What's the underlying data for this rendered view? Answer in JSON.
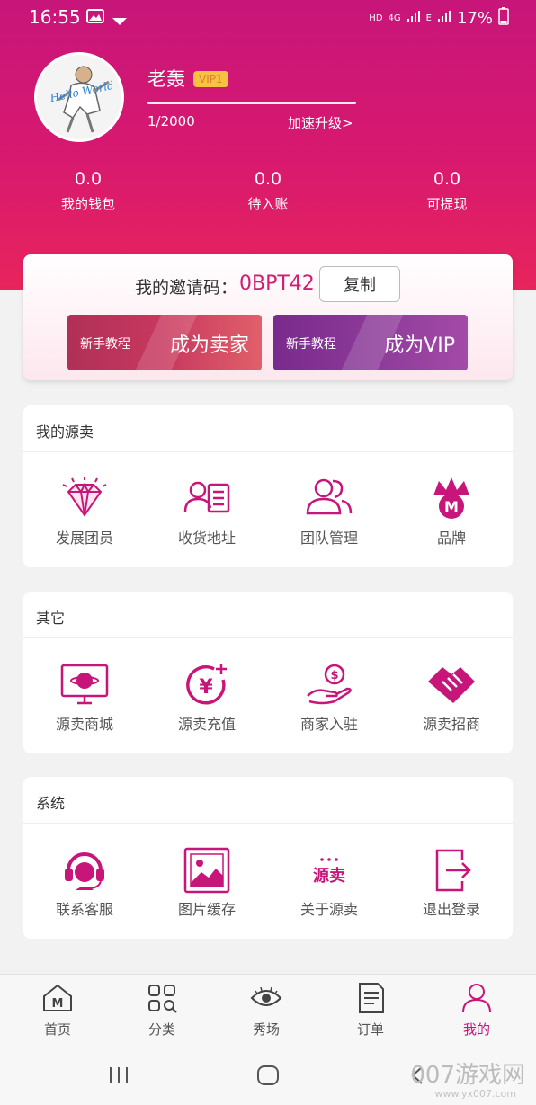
{
  "status_bar": {
    "time": "16:55",
    "hd": "HD",
    "net1": "4G",
    "net2": "E",
    "battery": "17%"
  },
  "profile": {
    "name": "老轰",
    "vip": "VIP1",
    "avatar_text": "Hello World",
    "level_progress": "1/2000",
    "upgrade_label": "加速升级>"
  },
  "stats": [
    {
      "value": "0.0",
      "label": "我的钱包"
    },
    {
      "value": "0.0",
      "label": "待入账"
    },
    {
      "value": "0.0",
      "label": "可提现"
    }
  ],
  "invite": {
    "label": "我的邀请码：",
    "code": "0BPT42",
    "copy_label": "复制",
    "seller_tag": "新手教程",
    "seller_label": "成为卖家",
    "vip_tag": "新手教程",
    "vip_label": "成为VIP"
  },
  "sections": [
    {
      "title": "我的源卖",
      "items": [
        {
          "label": "发展团员",
          "icon": "diamond-icon"
        },
        {
          "label": "收货地址",
          "icon": "address-card-icon"
        },
        {
          "label": "团队管理",
          "icon": "team-icon"
        },
        {
          "label": "品牌",
          "icon": "crown-brand-icon",
          "badge": "M"
        }
      ]
    },
    {
      "title": "其它",
      "items": [
        {
          "label": "源卖商城",
          "icon": "monitor-mall-icon"
        },
        {
          "label": "源卖充值",
          "icon": "yen-recharge-icon",
          "symbol": "¥"
        },
        {
          "label": "商家入驻",
          "icon": "hand-coin-icon",
          "symbol": "$"
        },
        {
          "label": "源卖招商",
          "icon": "handshake-icon"
        }
      ]
    },
    {
      "title": "系统",
      "items": [
        {
          "label": "联系客服",
          "icon": "headset-icon"
        },
        {
          "label": "图片缓存",
          "icon": "image-cache-icon"
        },
        {
          "label": "关于源卖",
          "icon": "about-logo-icon",
          "logo_text": "源卖"
        },
        {
          "label": "退出登录",
          "icon": "logout-icon"
        }
      ]
    }
  ],
  "nav": [
    {
      "label": "首页",
      "icon": "home-icon",
      "glyph": "M"
    },
    {
      "label": "分类",
      "icon": "category-icon"
    },
    {
      "label": "秀场",
      "icon": "eye-icon"
    },
    {
      "label": "订单",
      "icon": "order-icon"
    },
    {
      "label": "我的",
      "icon": "user-icon",
      "active": true
    }
  ],
  "watermark": {
    "text": "007游戏网",
    "sub": "www.yx007.com"
  },
  "colors": {
    "brand": "#c8157a",
    "accent": "#d01f6e",
    "header_bottom": "#e8245c"
  }
}
